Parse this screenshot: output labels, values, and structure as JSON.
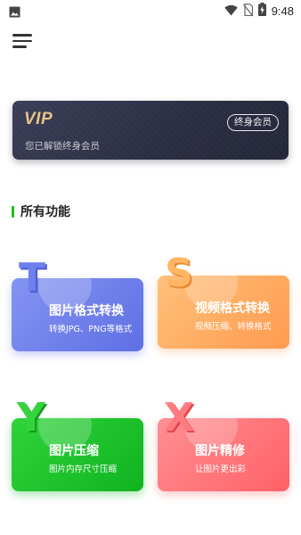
{
  "status_bar": {
    "time": "9:48",
    "icons": [
      "image-icon",
      "wifi-icon",
      "no-sim-icon",
      "battery-charging-icon"
    ]
  },
  "menu": {
    "icon": "menu-icon"
  },
  "vip": {
    "logo": "VIP",
    "subtitle": "您已解锁终身会员",
    "badge": "终身会员",
    "accent": "#e7c58b"
  },
  "section": {
    "title": "所有功能",
    "accent": "#19c11c"
  },
  "features": [
    {
      "letter": "T",
      "title": "图片格式转换",
      "desc": "转换JPG、PNG等格式",
      "color": "#6e80ee"
    },
    {
      "letter": "S",
      "title": "视频格式转换",
      "desc": "视频压缩、转换格式",
      "color": "#ff9b4f"
    },
    {
      "letter": "Y",
      "title": "图片压缩",
      "desc": "图片内存尺寸压缩",
      "color": "#0fb320"
    },
    {
      "letter": "X",
      "title": "图片精修",
      "desc": "让图片更出彩",
      "color": "#ff6166"
    }
  ]
}
